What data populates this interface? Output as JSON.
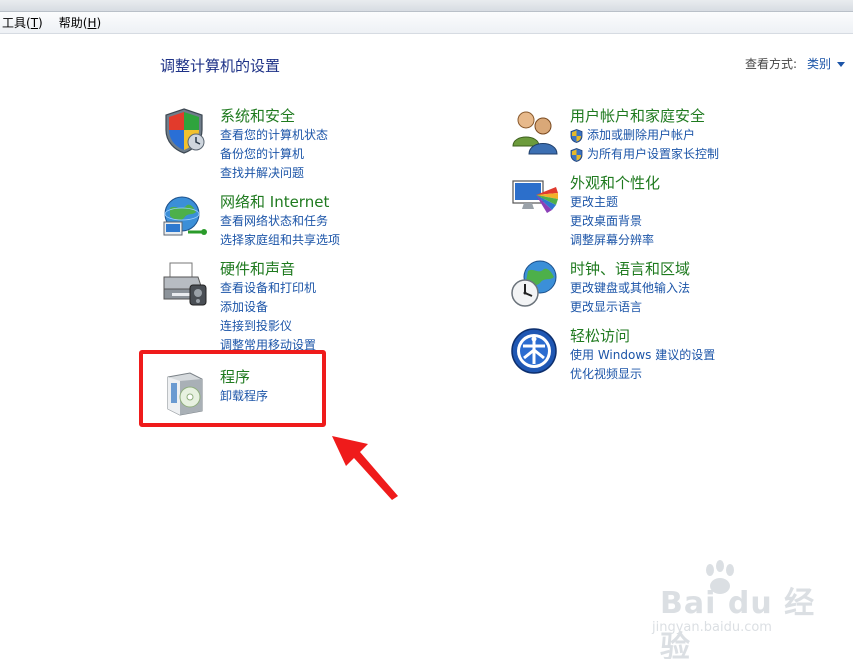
{
  "menu": {
    "tools": "工具",
    "tools_key": "T",
    "help": "帮助",
    "help_key": "H"
  },
  "header": {
    "title": "调整计算机的设置",
    "view_by_label": "查看方式:",
    "view_by_value": "类别"
  },
  "left_column": [
    {
      "id": "system-security",
      "icon": "shield-icon",
      "title": "系统和安全",
      "links": [
        "查看您的计算机状态",
        "备份您的计算机",
        "查找并解决问题"
      ]
    },
    {
      "id": "network-internet",
      "icon": "network-globe-icon",
      "title": "网络和 Internet",
      "links": [
        "查看网络状态和任务",
        "选择家庭组和共享选项"
      ]
    },
    {
      "id": "hardware-sound",
      "icon": "printer-icon",
      "title": "硬件和声音",
      "links": [
        "查看设备和打印机",
        "添加设备",
        "连接到投影仪",
        "调整常用移动设置"
      ]
    },
    {
      "id": "programs",
      "icon": "programs-box-icon",
      "title": "程序",
      "links": [
        "卸载程序"
      ]
    }
  ],
  "right_column": [
    {
      "id": "user-accounts",
      "icon": "users-icon",
      "title": "用户帐户和家庭安全",
      "links": [
        "添加或删除用户帐户",
        "为所有用户设置家长控制"
      ]
    },
    {
      "id": "appearance",
      "icon": "monitor-palette-icon",
      "title": "外观和个性化",
      "links": [
        "更改主题",
        "更改桌面背景",
        "调整屏幕分辨率"
      ]
    },
    {
      "id": "clock-region",
      "icon": "clock-globe-icon",
      "title": "时钟、语言和区域",
      "links": [
        "更改键盘或其他输入法",
        "更改显示语言"
      ]
    },
    {
      "id": "ease-of-access",
      "icon": "ease-access-icon",
      "title": "轻松访问",
      "links": [
        "使用 Windows 建议的设置",
        "优化视频显示"
      ]
    }
  ],
  "annotation": {
    "box_color": "#ef1b1b",
    "arrow_color": "#ef1b1b"
  },
  "watermark": {
    "brand": "Bai du 经验",
    "url": "jingyan.baidu.com"
  },
  "colors": {
    "category_title": "#1f7a1f",
    "link": "#1c55a8",
    "page_title": "#1e3287"
  }
}
